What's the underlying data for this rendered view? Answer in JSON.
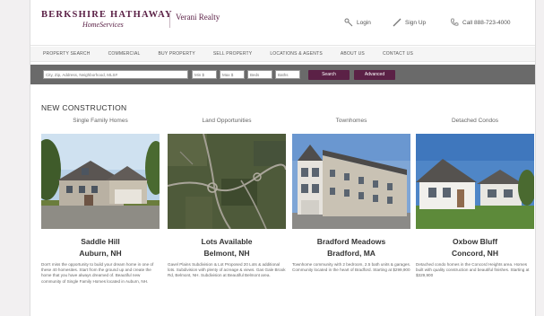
{
  "brand": {
    "line1": "BERKSHIRE HATHAWAY",
    "line2": "HomeServices",
    "agent": "Verani Realty"
  },
  "header_links": {
    "login": "Login",
    "signup": "Sign Up",
    "phone": "Call 888-723-4000"
  },
  "nav": [
    "PROPERTY SEARCH",
    "COMMERCIAL",
    "BUY PROPERTY",
    "SELL PROPERTY",
    "LOCATIONS & AGENTS",
    "ABOUT US",
    "CONTACT US"
  ],
  "search": {
    "placeholder": "City, Zip, Address, Neighborhood, MLS#",
    "min": "Min $",
    "max": "Max $",
    "beds": "Beds",
    "baths": "Baths",
    "search_btn": "Search",
    "advanced_btn": "Advanced"
  },
  "section_title": "NEW CONSTRUCTION",
  "cards": [
    {
      "category": "Single Family Homes",
      "name": "Saddle Hill",
      "location": "Auburn, NH",
      "desc": "Don't miss the opportunity to build your dream home in one of these 40 homesites. Start from the ground up and create the home that you have always dreamed of. Beautiful new community of Single Family Homes located in Auburn, NH."
    },
    {
      "category": "Land Opportunities",
      "name": "Lots Available",
      "location": "Belmont, NH",
      "desc": "Gavel Plains Subdivision & Lot Proposed 20 Lots & additional lots. Subdivision with plenty of acreage & views. Gas Gale Brook Rd, Belmont, NH. Subdivision at Beautiful Belmont area."
    },
    {
      "category": "Townhomes",
      "name": "Bradford Meadows",
      "location": "Bradford, MA",
      "desc": "Townhome community with 2 bedroom, 2.5 bath units & garages. Community located in the heart of Bradford. Starting at $299,900"
    },
    {
      "category": "Detached Condos",
      "name": "Oxbow Bluff",
      "location": "Concord, NH",
      "desc": "Detached condo homes in the Concord Heights area. Homes built with quality construction and beautiful finishes. Starting at $329,900"
    }
  ]
}
